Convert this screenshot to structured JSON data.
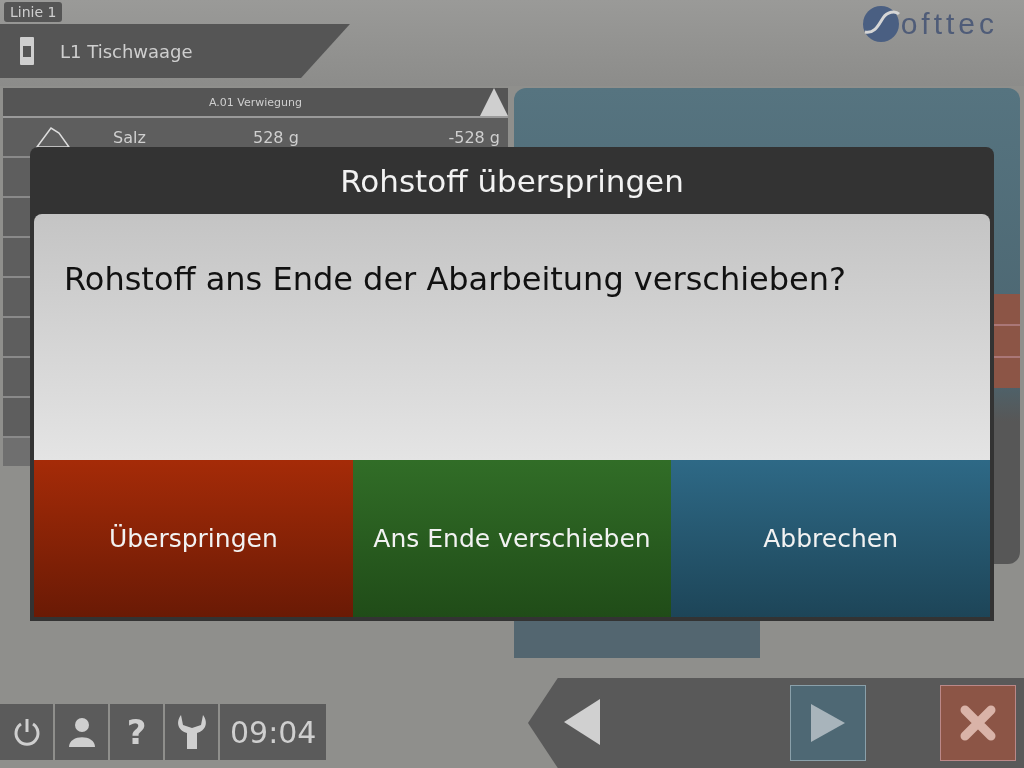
{
  "header": {
    "line_tab": "Linie 1",
    "station": "L1 Tischwaage",
    "logo_text": "ofttec"
  },
  "list": {
    "title": "A.01 Verwiegung",
    "rows": [
      {
        "name": "Salz",
        "target": "528 g",
        "difference": "-528 g"
      }
    ]
  },
  "dialog": {
    "title": "Rohstoff überspringen",
    "message": "Rohstoff ans Ende der Abarbeitung verschieben?",
    "buttons": [
      {
        "label": "Überspringen",
        "kind": "danger"
      },
      {
        "label": "Ans Ende verschieben",
        "kind": "confirm"
      },
      {
        "label": "Abbrechen",
        "kind": "cancel"
      }
    ]
  },
  "footer": {
    "help_glyph": "?",
    "time": "09:04"
  }
}
